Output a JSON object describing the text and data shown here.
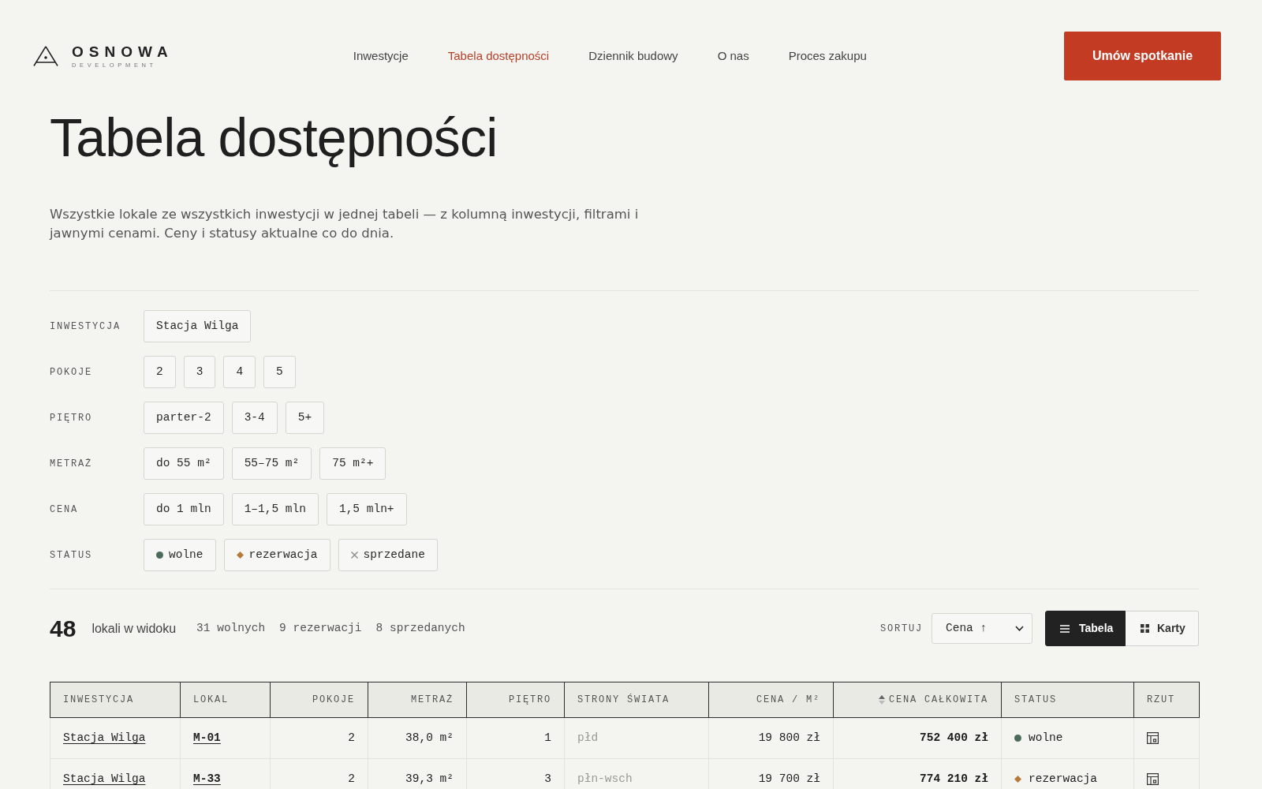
{
  "header": {
    "logo": {
      "name": "OSNOWA",
      "tagline": "DEVELOPMENT"
    },
    "nav": [
      {
        "label": "Inwestycje",
        "selected": false
      },
      {
        "label": "Tabela dostępności",
        "selected": true
      },
      {
        "label": "Dziennik budowy",
        "selected": false
      },
      {
        "label": "O nas",
        "selected": false
      },
      {
        "label": "Proces zakupu",
        "selected": false
      }
    ],
    "cta_button": "Umów spotkanie"
  },
  "title": "Tabela dostępności",
  "intro": "Wszystkie lokale ze wszystkich inwestycji w jednej tabeli — z kolumną inwestycji, filtrami i jawnymi cenami. Ceny i statusy aktualne co do dnia.",
  "filters": [
    {
      "label": "INWESTYCJA",
      "options": [
        {
          "label": "Stacja Wilga",
          "selected": false
        }
      ]
    },
    {
      "label": "POKOJE",
      "options": [
        {
          "label": "2",
          "selected": false
        },
        {
          "label": "3",
          "selected": false
        },
        {
          "label": "4",
          "selected": false
        },
        {
          "label": "5",
          "selected": false
        }
      ]
    },
    {
      "label": "PIĘTRO",
      "options": [
        {
          "label": "parter-2",
          "selected": false
        },
        {
          "label": "3-4",
          "selected": false
        },
        {
          "label": "5+",
          "selected": false
        }
      ]
    },
    {
      "label": "METRAŻ",
      "options": [
        {
          "label": "do 55 m²",
          "selected": false
        },
        {
          "label": "55–75 m²",
          "selected": false
        },
        {
          "label": "75 m²+",
          "selected": false
        }
      ]
    },
    {
      "label": "CENA",
      "options": [
        {
          "label": "do 1 mln",
          "selected": false
        },
        {
          "label": "1–1,5 mln",
          "selected": false
        },
        {
          "label": "1,5 mln+",
          "selected": false
        }
      ]
    },
    {
      "label": "STATUS",
      "options": [
        {
          "label": "wolne",
          "selected": false,
          "kind": "dot",
          "color": "#4d6b5b"
        },
        {
          "label": "rezerwacja",
          "selected": false,
          "kind": "diamond",
          "color": "#b57a3a"
        },
        {
          "label": "sprzedane",
          "selected": false,
          "kind": "cross",
          "color": "#8a8a86"
        }
      ]
    }
  ],
  "summary": {
    "count": "48",
    "count_label": "lokali w widoku",
    "stats": [
      "31 wolnych",
      "9 rezerwacji",
      "8 sprzedanych"
    ]
  },
  "sort": {
    "label": "SORTUJ",
    "value": "Cena ↑"
  },
  "view_toggle": [
    {
      "label": "Tabela",
      "kind": "list",
      "selected": true
    },
    {
      "label": "Karty",
      "kind": "grid",
      "selected": false
    }
  ],
  "table": {
    "columns": [
      {
        "label": "INWESTYCJA",
        "sorted": false
      },
      {
        "label": "LOKAL",
        "sorted": false
      },
      {
        "label": "POKOJE",
        "sorted": false
      },
      {
        "label": "METRAŻ",
        "sorted": false
      },
      {
        "label": "PIĘTRO",
        "sorted": false
      },
      {
        "label": "STRONY ŚWIATA",
        "sorted": false
      },
      {
        "label": "CENA / M²",
        "sorted": false
      },
      {
        "label": "CENA CAŁKOWITA",
        "sorted": true
      },
      {
        "label": "STATUS",
        "sorted": false
      },
      {
        "label": "RZUT",
        "sorted": false
      }
    ],
    "rows": [
      {
        "investment": "Stacja Wilga",
        "unit": "M-01",
        "rooms": "2",
        "area": "38,0 m²",
        "floor": "1",
        "orientation": "płd",
        "price_per_m2": "19 800 zł",
        "total_price": "752 400 zł",
        "status": {
          "label": "wolne",
          "kind": "dot",
          "color": "#4d6b5b"
        }
      },
      {
        "investment": "Stacja Wilga",
        "unit": "M-33",
        "rooms": "2",
        "area": "39,3 m²",
        "floor": "3",
        "orientation": "płn-wsch",
        "price_per_m2": "19 700 zł",
        "total_price": "774 210 zł",
        "status": {
          "label": "rezerwacja",
          "kind": "diamond",
          "color": "#b57a3a"
        }
      }
    ]
  }
}
